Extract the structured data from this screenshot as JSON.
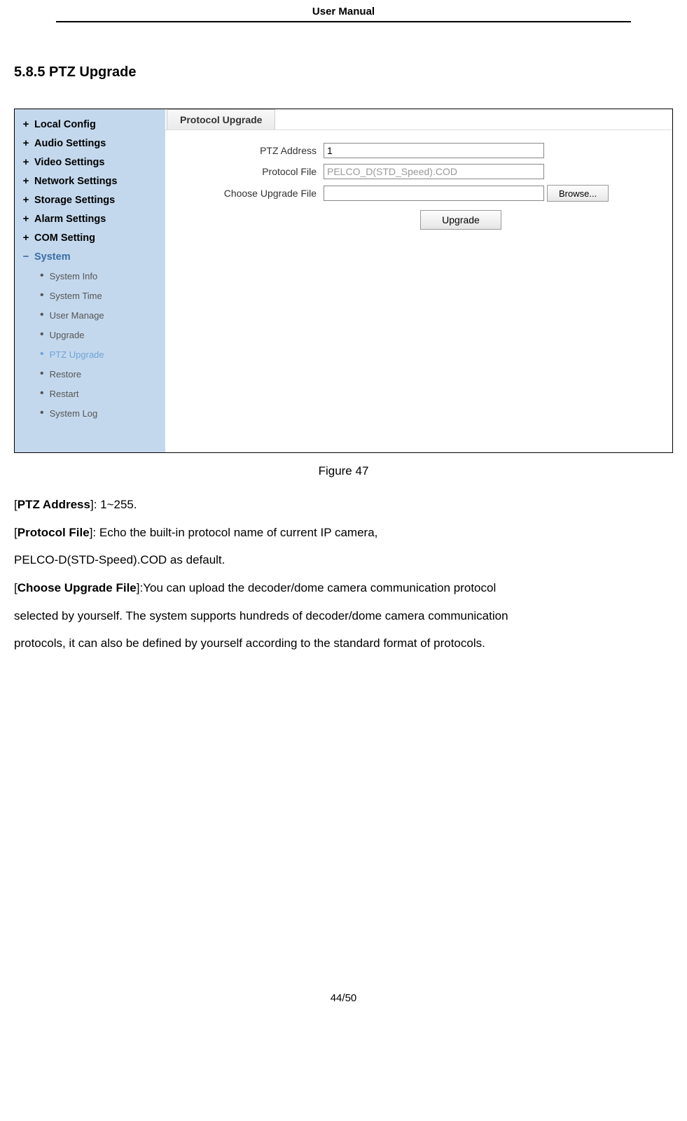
{
  "doc": {
    "header": "User Manual",
    "page": "44/50"
  },
  "section": {
    "title": "5.8.5 PTZ Upgrade"
  },
  "screenshot": {
    "sidebar": {
      "items": [
        {
          "label": "Local Config",
          "expanded": false
        },
        {
          "label": "Audio Settings",
          "expanded": false
        },
        {
          "label": "Video Settings",
          "expanded": false
        },
        {
          "label": "Network Settings",
          "expanded": false
        },
        {
          "label": "Storage Settings",
          "expanded": false
        },
        {
          "label": "Alarm Settings",
          "expanded": false
        },
        {
          "label": "COM Setting",
          "expanded": false
        }
      ],
      "expanded_item": {
        "label": "System"
      },
      "sub_items": [
        {
          "label": "System Info",
          "active": false
        },
        {
          "label": "System Time",
          "active": false
        },
        {
          "label": "User Manage",
          "active": false
        },
        {
          "label": "Upgrade",
          "active": false
        },
        {
          "label": "PTZ Upgrade",
          "active": true
        },
        {
          "label": "Restore",
          "active": false
        },
        {
          "label": "Restart",
          "active": false
        },
        {
          "label": "System Log",
          "active": false
        }
      ]
    },
    "tab": {
      "label": "Protocol Upgrade"
    },
    "form": {
      "ptz_address_label": "PTZ Address",
      "ptz_address_value": "1",
      "protocol_file_label": "Protocol File",
      "protocol_file_value": "PELCO_D(STD_Speed).COD",
      "upgrade_file_label": "Choose Upgrade File",
      "upgrade_file_value": "",
      "browse_button": "Browse...",
      "upgrade_button": "Upgrade"
    }
  },
  "figure": {
    "caption": "Figure 47"
  },
  "descriptions": {
    "ptz_address_key": "PTZ Address",
    "ptz_address_text": "]: 1~255.",
    "protocol_file_key": "Protocol File",
    "protocol_file_text": "]: Echo the built-in protocol name of current IP camera,",
    "protocol_file_text2": "PELCO-D(STD-Speed).COD as default.",
    "choose_key": "Choose Upgrade File",
    "choose_text": "]:You can upload the decoder/dome camera communication protocol",
    "choose_text2": "selected by yourself. The system supports hundreds of decoder/dome camera communication",
    "choose_text3": "protocols, it can also be defined by yourself according to the standard format of protocols."
  }
}
